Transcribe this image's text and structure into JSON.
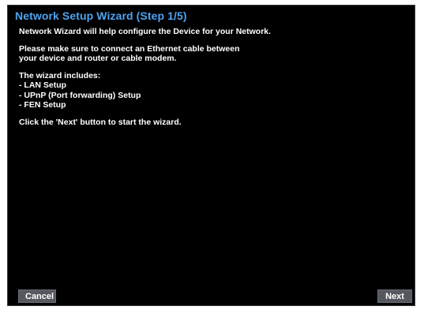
{
  "wizard": {
    "title": "Network Setup Wizard (Step 1/5)",
    "intro": "Network Wizard will help configure the Device for your Network.",
    "cable_note_line1": "Please make sure to connect an Ethernet cable between",
    "cable_note_line2": "your device and router or cable modem.",
    "includes_heading": "The wizard includes:",
    "includes_items": [
      "- LAN Setup",
      "- UPnP (Port forwarding) Setup",
      "- FEN Setup"
    ],
    "start_instruction": "Click the 'Next' button to start the wizard."
  },
  "buttons": {
    "cancel_label": "Cancel",
    "next_label": "Next"
  },
  "colors": {
    "background": "#000000",
    "title": "#4da3f0",
    "text": "#ffffff",
    "button": "#55585f"
  }
}
